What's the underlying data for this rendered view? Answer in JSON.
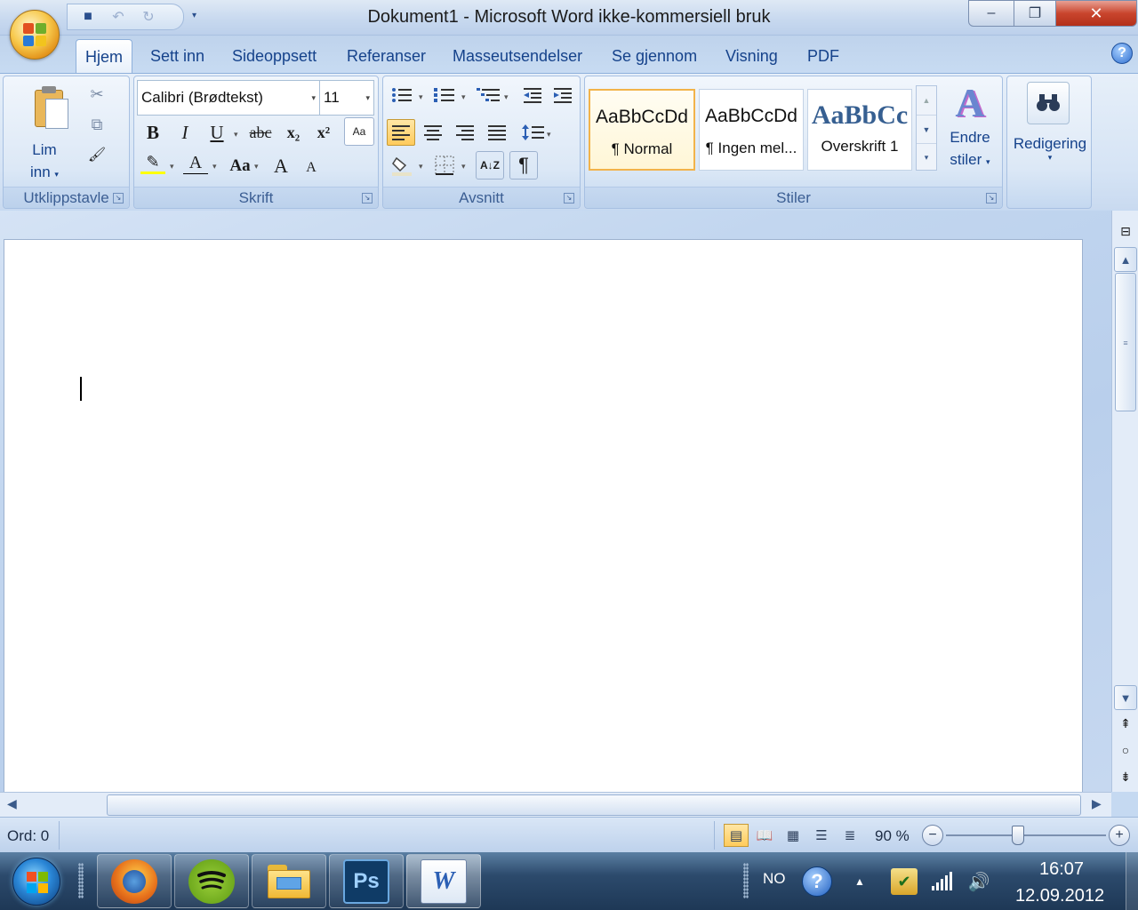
{
  "window": {
    "title": "Dokument1 - Microsoft Word ikke-kommersiell bruk",
    "minimize": "–",
    "maximize": "❐",
    "close": "✕"
  },
  "quick_access": {
    "items": [
      {
        "name": "save",
        "glyph": "💾"
      },
      {
        "name": "undo",
        "glyph": "↶"
      },
      {
        "name": "redo",
        "glyph": "↻"
      }
    ],
    "more": "▾"
  },
  "tabs": [
    "Hjem",
    "Sett inn",
    "Sideoppsett",
    "Referanser",
    "Masseutsendelser",
    "Se gjennom",
    "Visning",
    "PDF"
  ],
  "active_tab": "Hjem",
  "help_glyph": "?",
  "ribbon": {
    "clipboard": {
      "label": "Utklippstavle",
      "paste_line1": "Lim",
      "paste_line2": "inn",
      "cut": "✂",
      "copy": "⧉",
      "format_painter": "🖌"
    },
    "font": {
      "label": "Skrift",
      "font_name": "Calibri (Brødtekst)",
      "font_size": "11",
      "bold": "B",
      "italic": "I",
      "underline": "U",
      "strike": "abc",
      "subscript": "x₂",
      "superscript": "x²",
      "clear": "Aa",
      "highlight": "✎",
      "font_color": "A",
      "change_case": "Aa",
      "grow": "A",
      "shrink": "A",
      "highlight_color": "#ffff00",
      "font_color_value": "#000000"
    },
    "paragraph": {
      "label": "Avsnitt",
      "sort": "A↓Z",
      "pilcrow": "¶"
    },
    "styles": {
      "label": "Stiler",
      "tiles": [
        {
          "sample": "AaBbCcDd",
          "name": "¶ Normal"
        },
        {
          "sample": "AaBbCcDd",
          "name": "¶ Ingen mel..."
        },
        {
          "sample": "AaBbCc",
          "name": "Overskrift 1"
        }
      ],
      "change_line1": "Endre",
      "change_line2": "stiler"
    },
    "editing": {
      "label": "Redigering",
      "glyph": "🔭"
    }
  },
  "status": {
    "word_count": "Ord: 0",
    "zoom": "90 %",
    "zoom_value_percent": 90
  },
  "taskbar": {
    "apps": [
      {
        "name": "firefox",
        "label": "",
        "color": "#e8731c"
      },
      {
        "name": "spotify",
        "label": "",
        "color": "#7bb31a"
      },
      {
        "name": "explorer",
        "label": "",
        "color": "#f5c94c"
      },
      {
        "name": "photoshop",
        "label": "Ps",
        "color": "#0f3b66"
      },
      {
        "name": "word",
        "label": "W",
        "color": "#2b5fb4"
      }
    ],
    "language": "NO",
    "time": "16:07",
    "date": "12.09.2012"
  }
}
